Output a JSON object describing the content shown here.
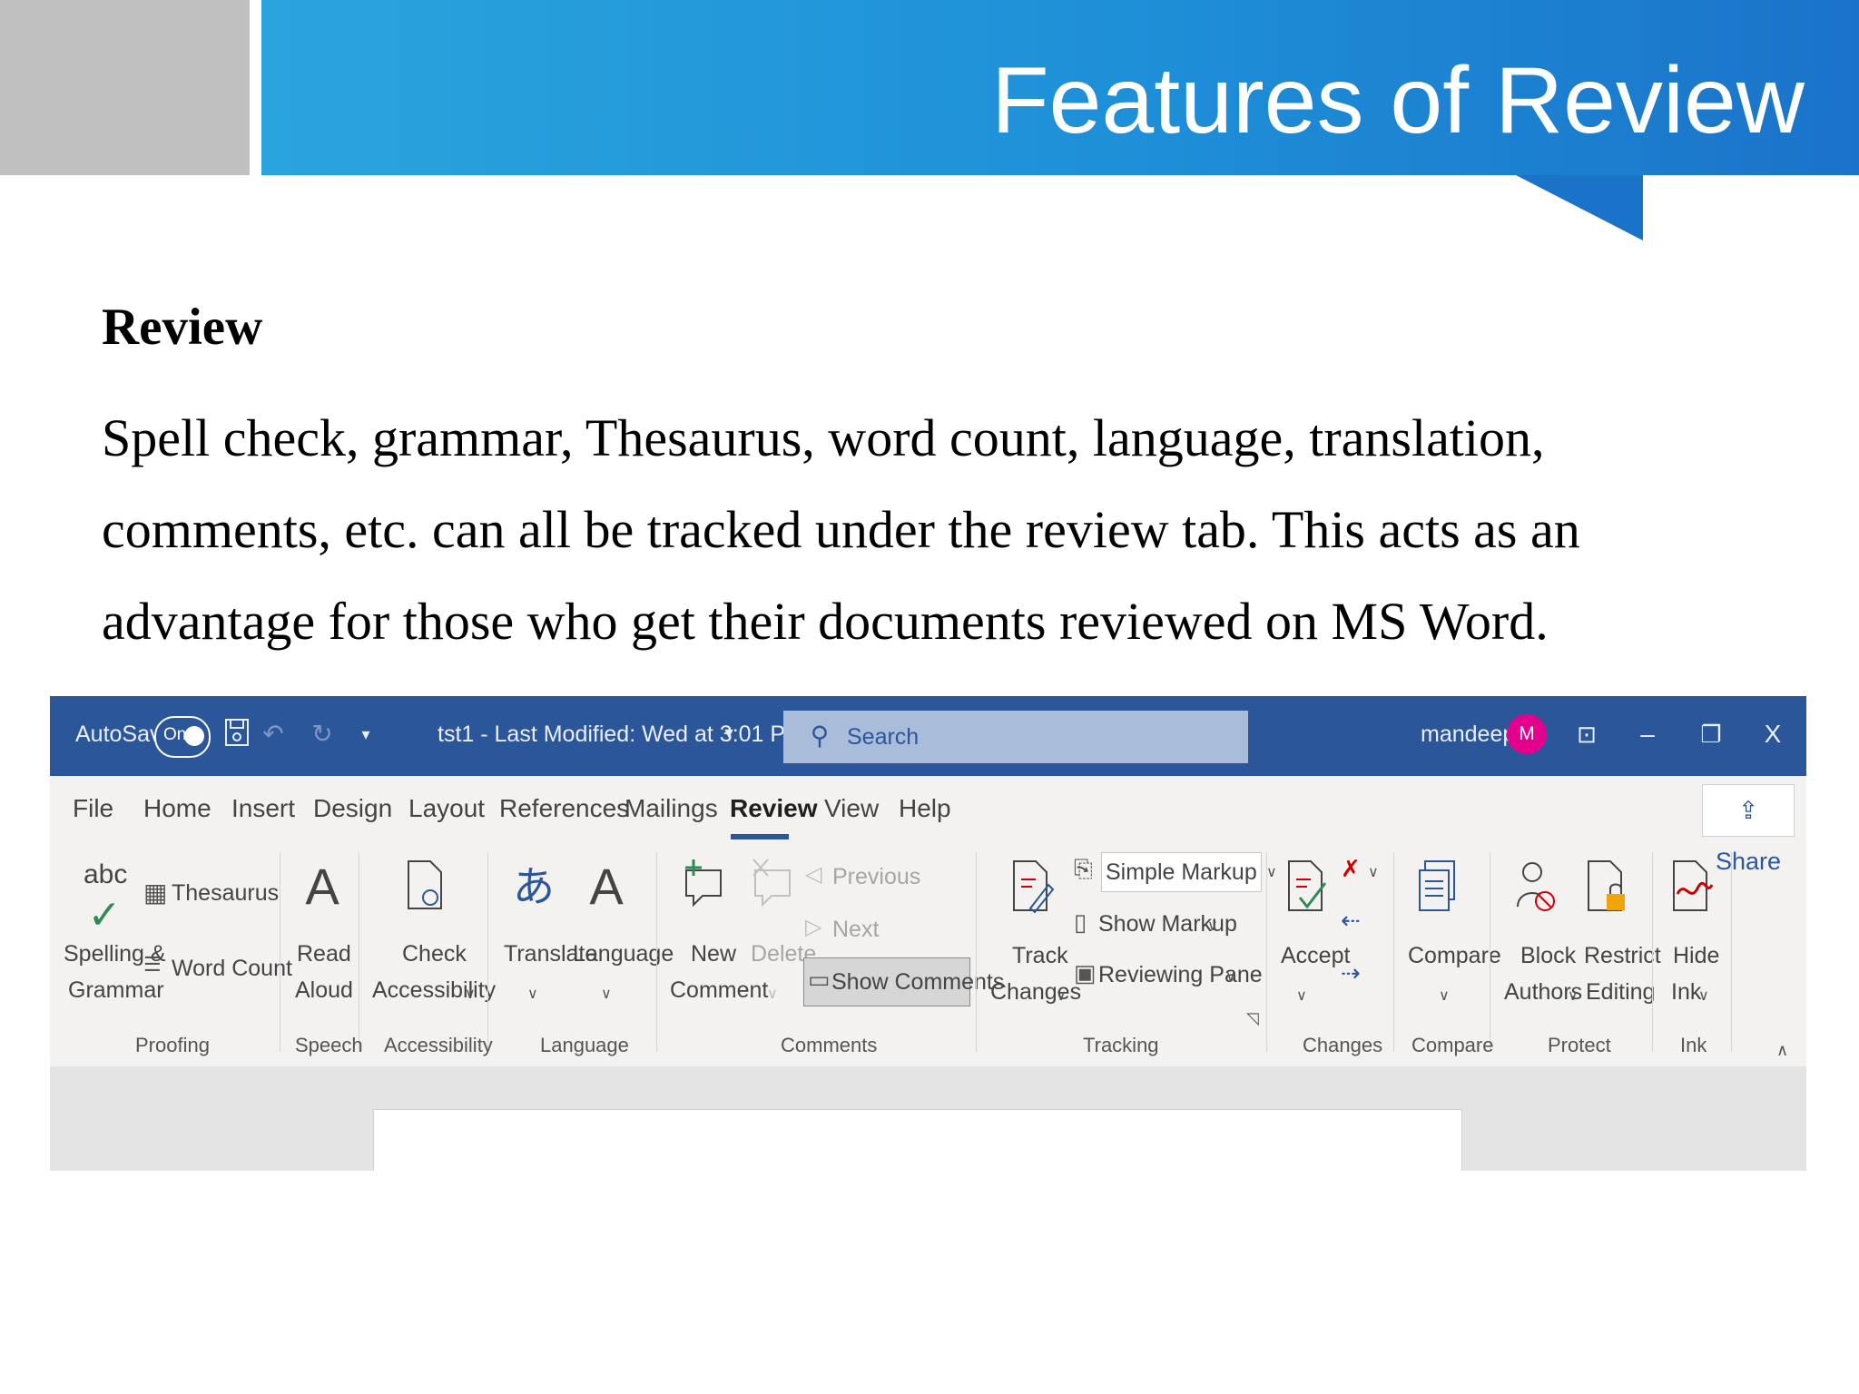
{
  "slide": {
    "title": "Features of Review",
    "heading": "Review",
    "paragraph_lines": [
      "Spell check, grammar, Thesaurus, word count, language, translation,",
      "comments, etc. can all be tracked under the review tab. This acts as an",
      "advantage for those who get their documents reviewed on MS Word."
    ],
    "colors": {
      "banner": "#1e8fd8",
      "gray_block": "#c0c0c0"
    }
  },
  "word": {
    "autosave_label": "AutoSave",
    "autosave_state": "On",
    "doc_title": "tst1  -  Last Modified: Wed at 3:01 PM",
    "search_placeholder": "Search",
    "user_name": "mandeep",
    "avatar_initial": "M",
    "close_label": "X",
    "menu": [
      "File",
      "Home",
      "Insert",
      "Design",
      "Layout",
      "References",
      "Mailings",
      "Review",
      "View",
      "Help"
    ],
    "active_tab": "Review",
    "share_label": "Share",
    "ribbon": {
      "abc": "abc",
      "thesaurus": "Thesaurus",
      "spelling1": "Spelling &",
      "spelling2": "Grammar",
      "word_count": "Word Count",
      "read1": "Read",
      "read2": "Aloud",
      "check1": "Check",
      "check2": "Accessibility",
      "translate": "Translate",
      "language": "Language",
      "new1": "New",
      "new2": "Comment",
      "delete": "Delete",
      "previous": "Previous",
      "next": "Next",
      "show_comments": "Show Comments",
      "track1": "Track",
      "track2": "Changes",
      "simple_markup": "Simple Markup",
      "show_markup": "Show Markup",
      "reviewing_pane": "Reviewing Pane",
      "accept": "Accept",
      "compare": "Compare",
      "block1": "Block",
      "block2": "Authors",
      "restrict1": "Restrict",
      "restrict2": "Editing",
      "hide1": "Hide",
      "hide2": "Ink"
    },
    "groups": [
      "Proofing",
      "Speech",
      "Accessibility",
      "Language",
      "Comments",
      "Tracking",
      "Changes",
      "Compare",
      "Protect",
      "Ink"
    ],
    "colors": {
      "titlebar": "#2b579a",
      "avatar": "#e3008c",
      "ribbon": "#f3f2f1"
    }
  }
}
